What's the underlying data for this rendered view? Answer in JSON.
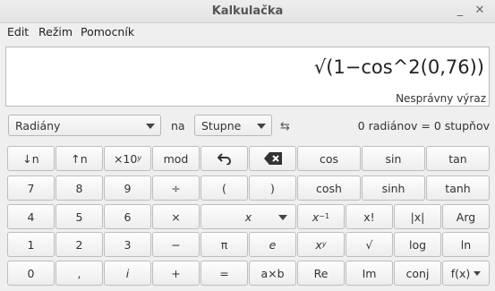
{
  "window": {
    "title": "Kalkulačka"
  },
  "menu": [
    "Edit",
    "Režim",
    "Pomocník"
  ],
  "display": {
    "expression": "√(1−cos^2(0,76))",
    "status": "Nesprávny výraz"
  },
  "angle": {
    "unit": "Radiány",
    "conjunction": "na",
    "target": "Stupne",
    "conversion": "0 radiánov = 0 stupňov"
  },
  "keys": {
    "r1": [
      "↓n",
      "↑n",
      "×10",
      "y",
      "mod",
      "cos",
      "sin",
      "tan"
    ],
    "r2": [
      "7",
      "8",
      "9",
      "÷",
      "(",
      ")",
      "cosh",
      "sinh",
      "tanh"
    ],
    "r3": [
      "4",
      "5",
      "6",
      "×",
      "x",
      "x",
      "−1",
      "x!",
      "|x|",
      "Arg"
    ],
    "r4": [
      "1",
      "2",
      "3",
      "−",
      "π",
      "e",
      "x",
      "y",
      "√",
      "log",
      "ln"
    ],
    "r5": [
      "0",
      ",",
      "i",
      "+",
      "=",
      "a×b",
      "Re",
      "Im",
      "conj",
      "f(x)"
    ]
  }
}
